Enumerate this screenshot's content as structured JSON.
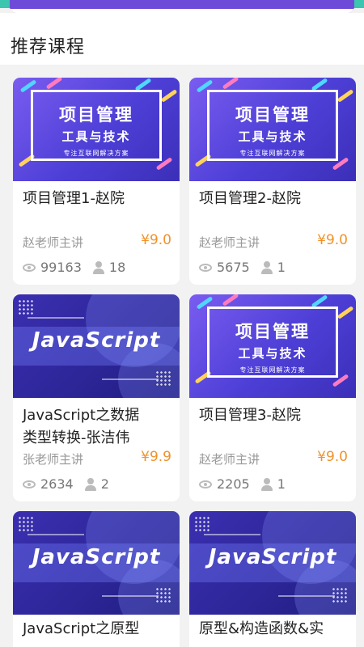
{
  "section": {
    "title": "推荐课程"
  },
  "thumbs": {
    "pm": {
      "title": "项目管理",
      "subtitle": "工具与技术",
      "tagline": "专注互联网解决方案"
    },
    "js": {
      "title": "JavaScript"
    }
  },
  "courses": [
    {
      "title": "项目管理1-赵院",
      "teacher": "赵老师主讲",
      "price": "¥9.0",
      "views": "99163",
      "students": "18"
    },
    {
      "title": "项目管理2-赵院",
      "teacher": "赵老师主讲",
      "price": "¥9.0",
      "views": "5675",
      "students": "1"
    },
    {
      "title_line1": "JavaScript之数据",
      "title_line2": "类型转换-张洁伟",
      "teacher": "张老师主讲",
      "price": "¥9.9",
      "views": "2634",
      "students": "2"
    },
    {
      "title": "项目管理3-赵院",
      "teacher": "赵老师主讲",
      "price": "¥9.0",
      "views": "2205",
      "students": "1"
    },
    {
      "title": "JavaScript之原型"
    },
    {
      "title": "原型&构造函数&实"
    }
  ],
  "colors": {
    "price": "#f0922b",
    "accent": "#3cc6b0"
  }
}
